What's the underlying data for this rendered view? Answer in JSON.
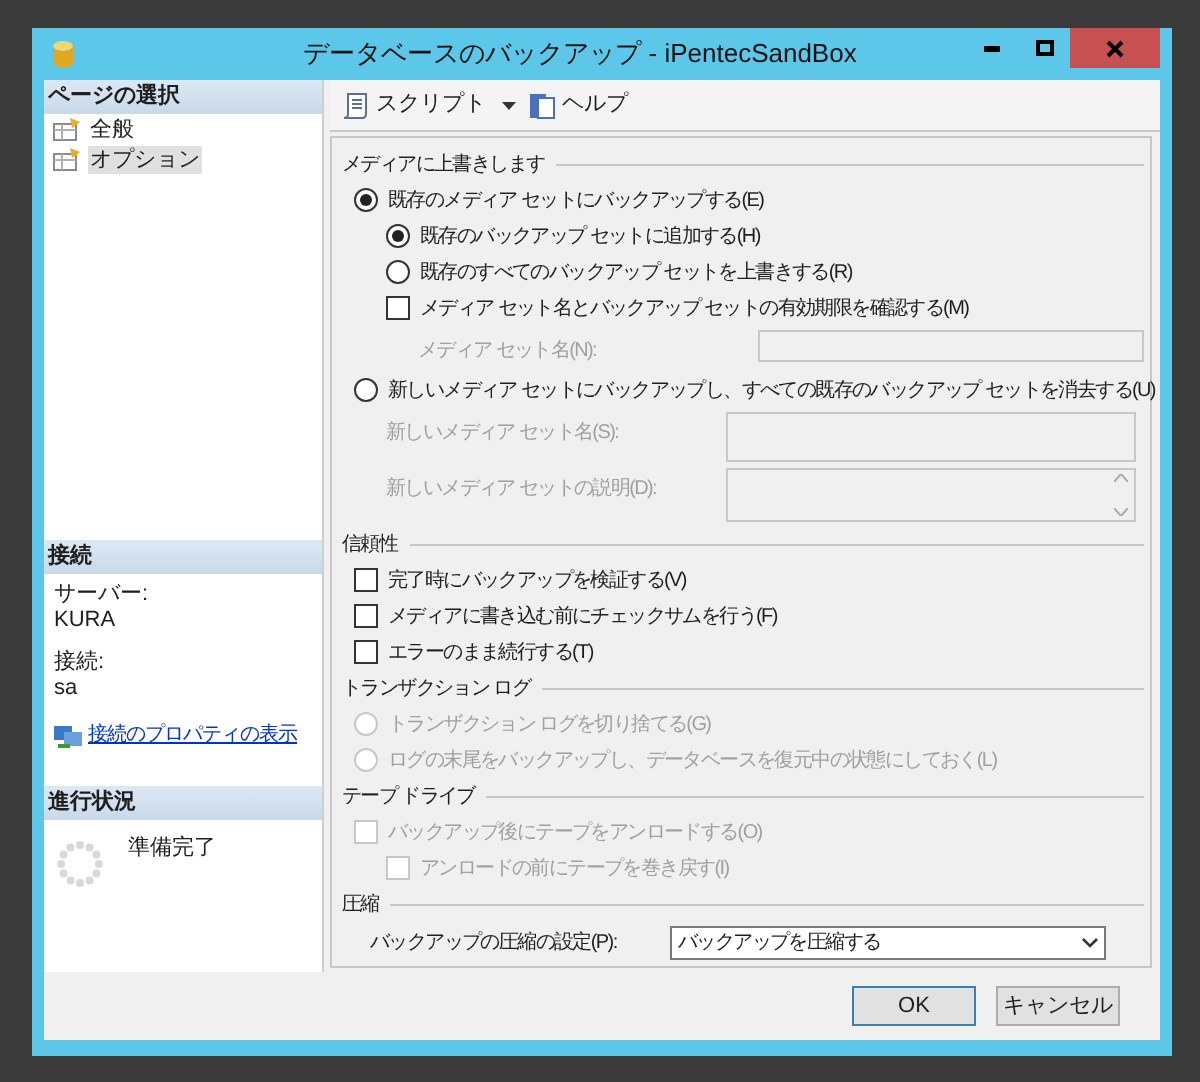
{
  "window": {
    "title": "データベースのバックアップ - iPentecSandBox"
  },
  "sidebar": {
    "page_select": {
      "title": "ページの選択",
      "items": [
        {
          "label": "全般",
          "selected": false
        },
        {
          "label": "オプション",
          "selected": true
        }
      ]
    },
    "connection": {
      "title": "接続",
      "server_label": "サーバー:",
      "server": "KURA",
      "login_label": "接続:",
      "login": "sa",
      "link": "接続のプロパティの表示"
    },
    "progress": {
      "title": "進行状況",
      "status": "準備完了"
    }
  },
  "toolbar": [
    {
      "label": "スクリプト",
      "kind": "script",
      "dropdown": true
    },
    {
      "label": "ヘルプ",
      "kind": "help",
      "dropdown": false
    }
  ],
  "sections": [
    {
      "title": "メディアに上書きします",
      "items": [
        {
          "kind": "radio",
          "label": "既存のメディア セットにバックアップする(E)",
          "checked": true,
          "disabled": false,
          "children": [
            {
              "kind": "radio",
              "label": "既存のバックアップ セットに追加する(H)",
              "checked": true,
              "disabled": false
            },
            {
              "kind": "radio",
              "label": "既存のすべてのバックアップ セットを上書きする(R)",
              "checked": false,
              "disabled": false
            },
            {
              "kind": "checkbox",
              "label": "メディア セット名とバックアップ セットの有効期限を確認する(M)",
              "checked": false,
              "disabled": false,
              "children": [
                {
                  "kind": "field",
                  "label": "メディア セット名(N):",
                  "disabled": true
                }
              ]
            }
          ]
        },
        {
          "kind": "radio",
          "label": "新しいメディア セットにバックアップし、すべての既存のバックアップ セットを消去する(U)",
          "checked": false,
          "disabled": false,
          "children": [
            {
              "kind": "field",
              "label": "新しいメディア セット名(S):",
              "disabled": true,
              "tall": true
            },
            {
              "kind": "textarea",
              "label": "新しいメディア セットの説明(D):",
              "disabled": true
            }
          ]
        }
      ]
    },
    {
      "title": "信頼性",
      "items": [
        {
          "kind": "checkbox",
          "label": "完了時にバックアップを検証する(V)",
          "checked": false,
          "disabled": false
        },
        {
          "kind": "checkbox",
          "label": "メディアに書き込む前にチェックサムを行う(F)",
          "checked": false,
          "disabled": false
        },
        {
          "kind": "checkbox",
          "label": "エラーのまま続行する(T)",
          "checked": false,
          "disabled": false
        }
      ]
    },
    {
      "title": "トランザクション ログ",
      "items": [
        {
          "kind": "radio",
          "label": "トランザクション ログを切り捨てる(G)",
          "checked": false,
          "disabled": true
        },
        {
          "kind": "radio",
          "label": "ログの末尾をバックアップし、データベースを復元中の状態にしておく(L)",
          "checked": false,
          "disabled": true
        }
      ]
    },
    {
      "title": "テープ ドライブ",
      "items": [
        {
          "kind": "checkbox",
          "label": "バックアップ後にテープをアンロードする(O)",
          "checked": false,
          "disabled": true,
          "children": [
            {
              "kind": "checkbox",
              "label": "アンロードの前にテープを巻き戻す(I)",
              "checked": false,
              "disabled": true
            }
          ]
        }
      ]
    },
    {
      "title": "圧縮",
      "items": [
        {
          "kind": "select",
          "label": "バックアップの圧縮の設定(P):",
          "value": "バックアップを圧縮する",
          "disabled": false
        }
      ]
    }
  ],
  "buttons": [
    {
      "label": "OK",
      "default": true
    },
    {
      "label": "キャンセル",
      "default": false
    }
  ]
}
